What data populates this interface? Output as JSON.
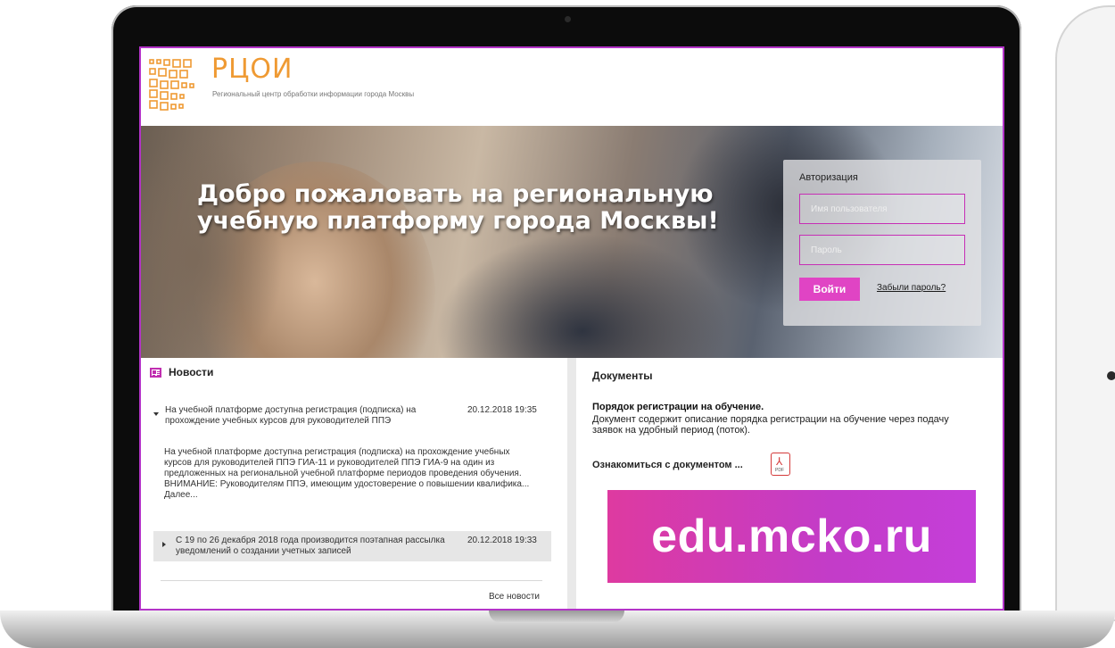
{
  "header": {
    "logo_title": "РЦОИ",
    "logo_subtitle": "Региональный центр обработки информации города Москвы"
  },
  "hero": {
    "title": "Добро пожаловать на региональную учебную платформу города Москвы!"
  },
  "auth": {
    "title": "Авторизация",
    "username_placeholder": "Имя пользователя",
    "password_placeholder": "Пароль",
    "login_label": "Войти",
    "forgot_label": "Забыли пароль?"
  },
  "news": {
    "heading": "Новости",
    "items": [
      {
        "title": "На учебной платформе доступна регистрация (подписка) на прохождение учебных курсов для руководителей ППЭ",
        "date": "20.12.2018 19:35",
        "body": "На учебной платформе доступна регистрация (подписка) на прохождение учебных курсов для руководителей ППЭ ГИА-11 и руководителей ППЭ ГИА-9 на один из предложенных на региональной учебной платформе периодов проведения обучения.  ВНИМАНИЕ: Руководителям ППЭ, имеющим удостоверение о повышении квалифика... Далее..."
      },
      {
        "title": "С 19 по 26 декабря 2018 года производится поэтапная рассылка уведомлений о создании учетных записей",
        "date": "20.12.2018 19:33"
      }
    ],
    "all_news_label": "Все новости"
  },
  "documents": {
    "heading": "Документы",
    "doc_title": "Порядок регистрации на обучение.",
    "doc_description": "Документ содержит описание порядка регистрации на обучение через подачу заявок на удобный период (поток).",
    "doc_link": "Ознакомиться с документом ...",
    "pdf_badge": "PDF"
  },
  "banner": {
    "url": "edu.mcko.ru"
  },
  "colors": {
    "accent": "#e044c4",
    "logo_orange": "#ef9a33",
    "screen_border": "#b333c8"
  }
}
